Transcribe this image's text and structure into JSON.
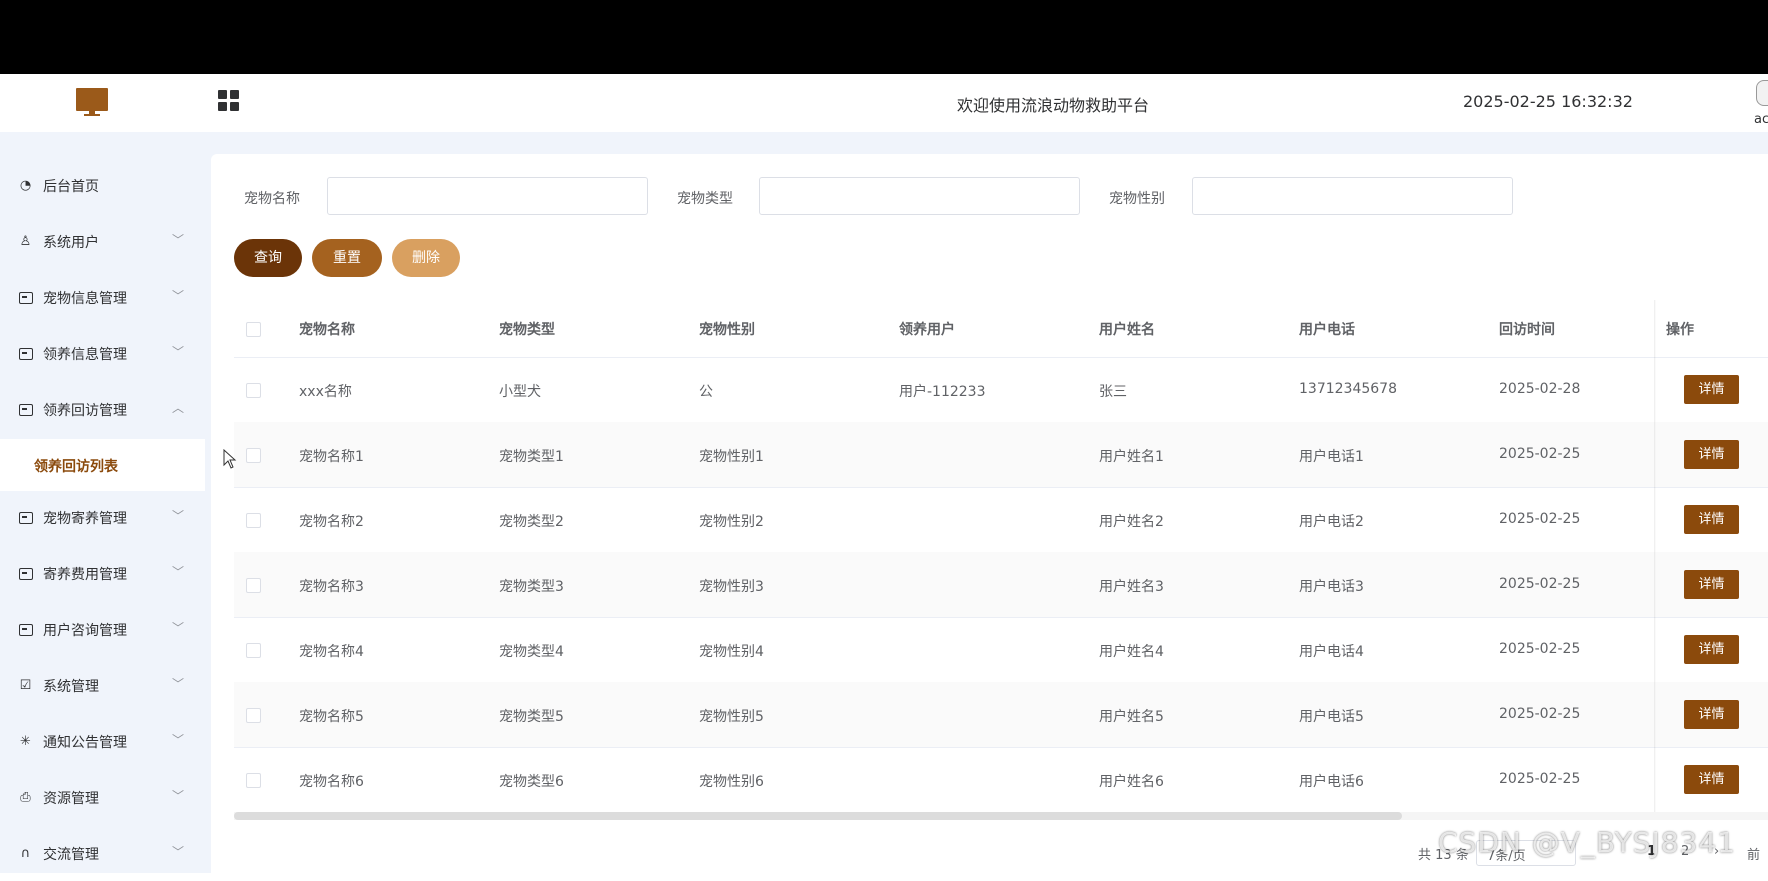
{
  "header": {
    "app_title": "欢迎使用流浪动物救助平台",
    "datetime": "2025-02-25 16:32:32",
    "user_name": "ac"
  },
  "sidebar": {
    "items": [
      {
        "label": "后台首页",
        "icon": "pie-chart-icon",
        "expandable": false
      },
      {
        "label": "系统用户",
        "icon": "user-icon",
        "expandable": true
      },
      {
        "label": "宠物信息管理",
        "icon": "card-icon",
        "expandable": true
      },
      {
        "label": "领养信息管理",
        "icon": "card-icon",
        "expandable": true
      },
      {
        "label": "领养回访管理",
        "icon": "card-icon",
        "expandable": true,
        "expanded": true
      },
      {
        "label": "领养回访列表",
        "sub": true,
        "active": true
      },
      {
        "label": "宠物寄养管理",
        "icon": "card-icon",
        "expandable": true
      },
      {
        "label": "寄养费用管理",
        "icon": "card-icon",
        "expandable": true
      },
      {
        "label": "用户咨询管理",
        "icon": "card-icon",
        "expandable": true
      },
      {
        "label": "系统管理",
        "icon": "checkbox-icon",
        "expandable": true
      },
      {
        "label": "通知公告管理",
        "icon": "loading-icon",
        "expandable": true
      },
      {
        "label": "资源管理",
        "icon": "printer-icon",
        "expandable": true
      },
      {
        "label": "交流管理",
        "icon": "headset-icon",
        "expandable": true
      }
    ]
  },
  "search": {
    "fields": [
      {
        "label": "宠物名称",
        "value": ""
      },
      {
        "label": "宠物类型",
        "value": ""
      },
      {
        "label": "宠物性别",
        "value": ""
      }
    ],
    "query_label": "查询",
    "reset_label": "重置",
    "delete_label": "删除"
  },
  "colors": {
    "primary": "#8b4a0c",
    "query_btn": "#6b3408",
    "reset_btn": "#a5621f",
    "delete_btn": "#d9a060",
    "sidebar_bg": "#f0f4fb"
  },
  "table": {
    "columns": [
      "宠物名称",
      "宠物类型",
      "宠物性别",
      "领养用户",
      "用户姓名",
      "用户电话",
      "回访时间",
      "操作"
    ],
    "rows": [
      {
        "name": "xxx名称",
        "type": "小型犬",
        "gender": "公",
        "adopter": "用户-112233",
        "user_name": "张三",
        "phone": "13712345678",
        "visit_time": "2025-02-28",
        "action": "详情"
      },
      {
        "name": "宠物名称1",
        "type": "宠物类型1",
        "gender": "宠物性别1",
        "adopter": "",
        "user_name": "用户姓名1",
        "phone": "用户电话1",
        "visit_time": "2025-02-25",
        "action": "详情"
      },
      {
        "name": "宠物名称2",
        "type": "宠物类型2",
        "gender": "宠物性别2",
        "adopter": "",
        "user_name": "用户姓名2",
        "phone": "用户电话2",
        "visit_time": "2025-02-25",
        "action": "详情"
      },
      {
        "name": "宠物名称3",
        "type": "宠物类型3",
        "gender": "宠物性别3",
        "adopter": "",
        "user_name": "用户姓名3",
        "phone": "用户电话3",
        "visit_time": "2025-02-25",
        "action": "详情"
      },
      {
        "name": "宠物名称4",
        "type": "宠物类型4",
        "gender": "宠物性别4",
        "adopter": "",
        "user_name": "用户姓名4",
        "phone": "用户电话4",
        "visit_time": "2025-02-25",
        "action": "详情"
      },
      {
        "name": "宠物名称5",
        "type": "宠物类型5",
        "gender": "宠物性别5",
        "adopter": "",
        "user_name": "用户姓名5",
        "phone": "用户电话5",
        "visit_time": "2025-02-25",
        "action": "详情"
      },
      {
        "name": "宠物名称6",
        "type": "宠物类型6",
        "gender": "宠物性别6",
        "adopter": "",
        "user_name": "用户姓名6",
        "phone": "用户电话6",
        "visit_time": "2025-02-25",
        "action": "详情"
      }
    ]
  },
  "pagination": {
    "total_text": "共 13 条",
    "page_size_text": "7条/页",
    "pages": [
      "1",
      "2"
    ],
    "next_icon": "chevron-right-icon",
    "jump_text": "前"
  },
  "watermark": "CSDN @V_BYSJ8341"
}
